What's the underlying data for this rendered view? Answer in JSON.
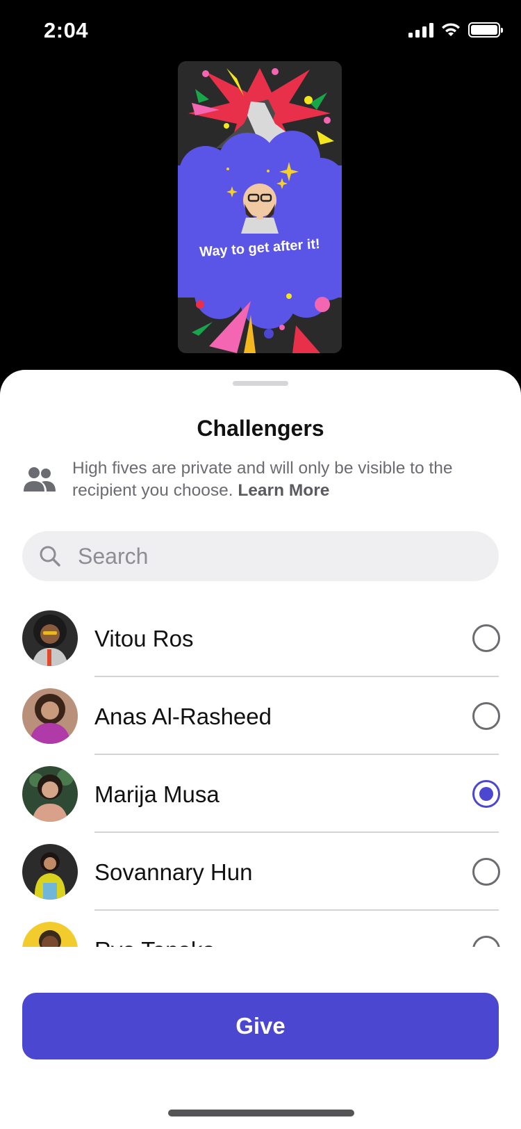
{
  "status_bar": {
    "time": "2:04"
  },
  "card": {
    "message": "Way to get after it!"
  },
  "sheet": {
    "title": "Challengers",
    "info_text": "High fives are private and will only be visible to the recipient you choose.",
    "info_link": "Learn More",
    "search_placeholder": "Search",
    "search_value": "",
    "selected_index": 2,
    "recipients": [
      {
        "name": "Vitou Ros",
        "selected": false
      },
      {
        "name": "Anas Al-Rasheed",
        "selected": false
      },
      {
        "name": "Marija Musa",
        "selected": true
      },
      {
        "name": "Sovannary Hun",
        "selected": false
      },
      {
        "name": "Ryo Tanaka",
        "selected": false
      }
    ],
    "give_label": "Give"
  },
  "colors": {
    "accent": "#4b47d1",
    "card_cloud": "#5a55e6",
    "card_bg": "#2a2a2a"
  },
  "icons": {
    "people": "people-icon",
    "search": "search-icon"
  }
}
